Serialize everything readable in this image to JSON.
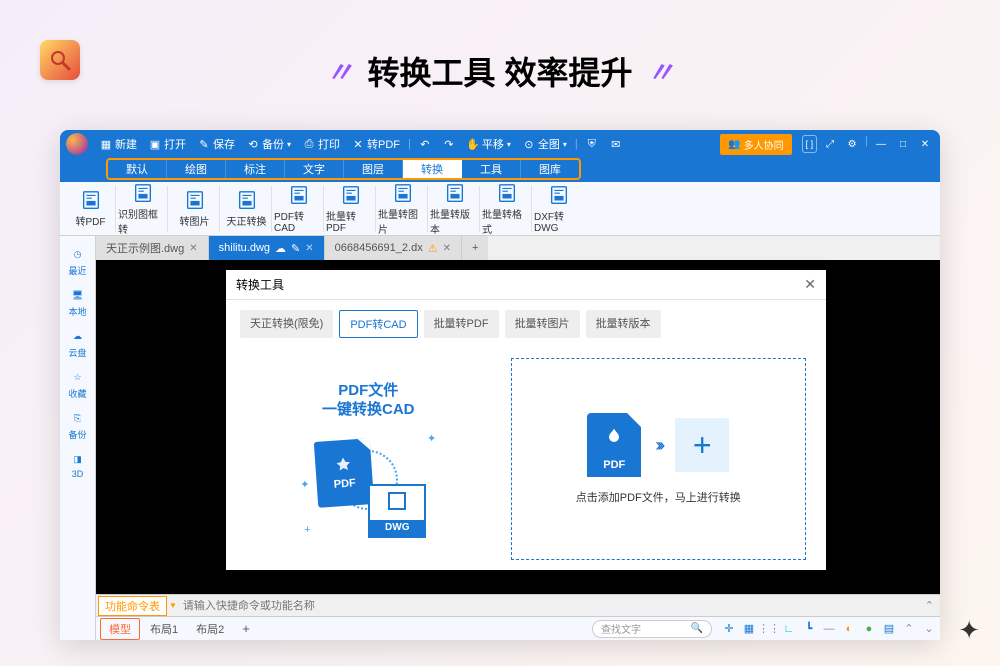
{
  "headline": "转换工具 效率提升",
  "top_menu": {
    "new": "新建",
    "open": "打开",
    "save": "保存",
    "backup": "备份",
    "print": "打印",
    "to_pdf": "转PDF",
    "pan": "平移",
    "fullscreen": "全图"
  },
  "collab_btn": "多人协同",
  "ribbon_tabs": [
    "默认",
    "绘图",
    "标注",
    "文字",
    "图层",
    "转换",
    "工具",
    "图库"
  ],
  "ribbon_active_index": 5,
  "toolbar": [
    {
      "label": "转PDF",
      "name": "to-pdf"
    },
    {
      "label": "识别图框转",
      "name": "recognize-frame"
    },
    {
      "label": "转图片",
      "name": "to-image"
    },
    {
      "label": "天正转换",
      "name": "tianzheng"
    },
    {
      "label": "PDF转CAD",
      "name": "pdf-to-cad"
    },
    {
      "label": "批量转PDF",
      "name": "batch-pdf"
    },
    {
      "label": "批量转图片",
      "name": "batch-image"
    },
    {
      "label": "批量转版本",
      "name": "batch-version"
    },
    {
      "label": "批量转格式",
      "name": "batch-format"
    },
    {
      "label": "DXF转DWG",
      "name": "dxf-to-dwg"
    }
  ],
  "sidebar": [
    {
      "label": "最近",
      "name": "recent"
    },
    {
      "label": "本地",
      "name": "local"
    },
    {
      "label": "云盘",
      "name": "cloud"
    },
    {
      "label": "收藏",
      "name": "favorite"
    },
    {
      "label": "备份",
      "name": "backup"
    },
    {
      "label": "3D",
      "name": "three-d"
    }
  ],
  "file_tabs": [
    {
      "label": "天正示例图.dwg",
      "active": false
    },
    {
      "label": "shilitu.dwg",
      "active": true,
      "cloud": true
    },
    {
      "label": "0668456691_2.dx",
      "active": false,
      "warn": true
    }
  ],
  "dialog": {
    "title": "转换工具",
    "tabs": [
      "天正转换(限免)",
      "PDF转CAD",
      "批量转PDF",
      "批量转图片",
      "批量转版本"
    ],
    "active_tab_index": 1,
    "left_title_l1": "PDF文件",
    "left_title_l2": "一键转换CAD",
    "pdf_label": "PDF",
    "dwg_label": "DWG",
    "hint": "点击添加PDF文件，马上进行转换"
  },
  "cmd": {
    "label": "功能命令表",
    "placeholder": "请输入快捷命令或功能名称"
  },
  "bottom": {
    "model": "模型",
    "layout1": "布局1",
    "layout2": "布局2",
    "search_placeholder": "查找文字"
  }
}
